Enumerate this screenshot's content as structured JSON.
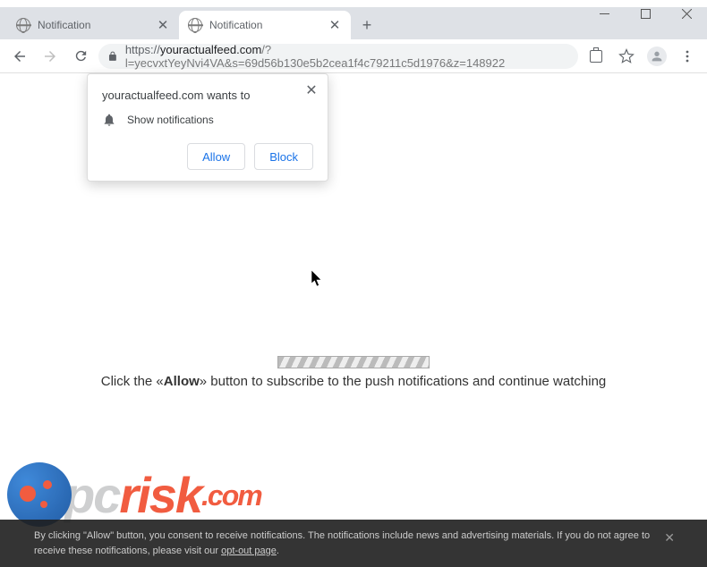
{
  "window": {
    "min": "–",
    "max": "☐",
    "close": "✕"
  },
  "tabs": [
    {
      "title": "Notification",
      "active": false
    },
    {
      "title": "Notification",
      "active": true
    }
  ],
  "newtab": "+",
  "address": {
    "scheme": "https://",
    "host": "youractualfeed.com",
    "path": "/?l=yecvxtYeyNvi4VA&s=69d56b130e5b2cea1f4c79211c5d1976&z=148922"
  },
  "permission": {
    "title": "youractualfeed.com wants to",
    "item": "Show notifications",
    "allow": "Allow",
    "block": "Block",
    "close": "✕"
  },
  "page": {
    "msg_pre": "Click the «",
    "msg_bold": "Allow",
    "msg_post": "» button to subscribe to the push notifications and continue watching"
  },
  "watermark": {
    "pc": "pc",
    "risk": "risk",
    "com": ".com"
  },
  "cookie": {
    "text1": "By clicking \"Allow\" button, you consent to receive notifications. The notifications include news and advertising materials. If you do not agree to receive these notifications, please visit our ",
    "link": "opt-out page",
    "close": "✕"
  }
}
